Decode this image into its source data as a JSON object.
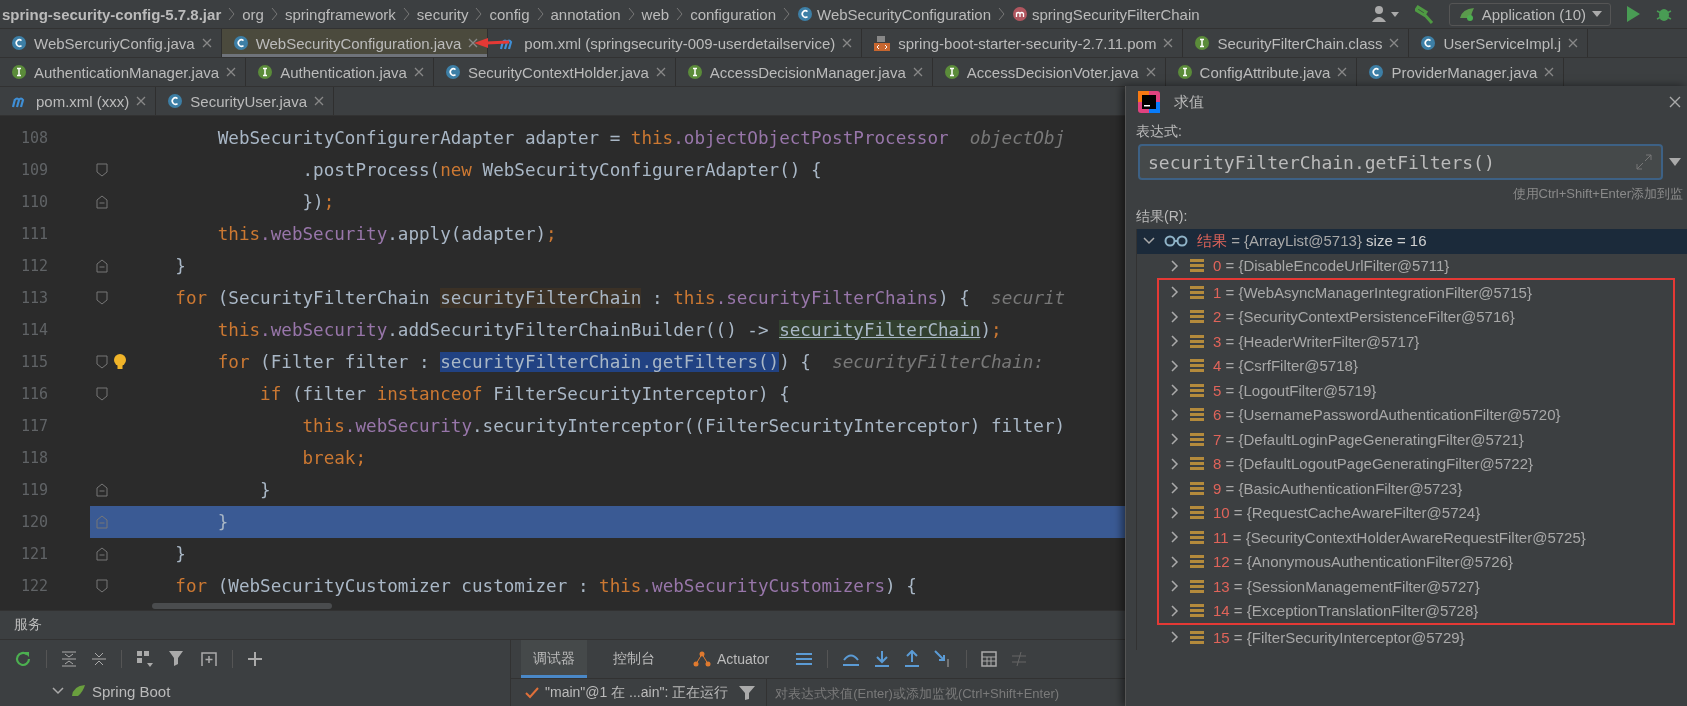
{
  "breadcrumb": [
    {
      "label": "spring-security-config-5.7.8.jar",
      "kind": "jar"
    },
    {
      "label": "org",
      "kind": "package"
    },
    {
      "label": "springframework",
      "kind": "package"
    },
    {
      "label": "security",
      "kind": "package"
    },
    {
      "label": "config",
      "kind": "package"
    },
    {
      "label": "annotation",
      "kind": "package"
    },
    {
      "label": "web",
      "kind": "package"
    },
    {
      "label": "configuration",
      "kind": "package"
    },
    {
      "label": "WebSecurityConfiguration",
      "kind": "class"
    },
    {
      "label": "springSecurityFilterChain",
      "kind": "method"
    }
  ],
  "toolbar": {
    "run_config": "Application (10)"
  },
  "tab_rows": [
    [
      {
        "label": "WebSercuriyConfig.java",
        "kind": "class",
        "selected": false
      },
      {
        "label": "WebSecurityConfiguration.java",
        "kind": "class",
        "selected": true
      },
      {
        "label": "pom.xml (springsecurity-009-userdetailservice)",
        "kind": "maven",
        "selected": false
      },
      {
        "label": "spring-boot-starter-security-2.7.11.pom",
        "kind": "pom",
        "selected": false
      },
      {
        "label": "SecurityFilterChain.class",
        "kind": "interface",
        "selected": false
      },
      {
        "label": "UserServiceImpl.j",
        "kind": "class",
        "selected": false
      }
    ],
    [
      {
        "label": "AuthenticationManager.java",
        "kind": "interface",
        "selected": false
      },
      {
        "label": "Authentication.java",
        "kind": "interface",
        "selected": false
      },
      {
        "label": "SecurityContextHolder.java",
        "kind": "class",
        "selected": false
      },
      {
        "label": "AccessDecisionManager.java",
        "kind": "interface",
        "selected": false
      },
      {
        "label": "AccessDecisionVoter.java",
        "kind": "interface",
        "selected": false
      },
      {
        "label": "ConfigAttribute.java",
        "kind": "interface",
        "selected": false
      },
      {
        "label": "ProviderManager.java",
        "kind": "class",
        "selected": false
      }
    ],
    [
      {
        "label": "pom.xml (xxx)",
        "kind": "maven",
        "selected": false
      },
      {
        "label": "SecurityUser.java",
        "kind": "class",
        "selected": false
      }
    ]
  ],
  "editor": {
    "lines": [
      {
        "number": "108",
        "kind": "plain",
        "bulb": false,
        "current": false,
        "segments": [
          {
            "text": "        WebSecurityConfigurerAdapter adapter = ",
            "kind": "plain"
          },
          {
            "text": "this",
            "kind": "keyword"
          },
          {
            "text": ".objectObjectPostProcessor",
            "kind": "field"
          },
          {
            "text": "  objectObj",
            "kind": "hint"
          }
        ]
      },
      {
        "number": "109",
        "kind": "fold_start",
        "bulb": false,
        "current": false,
        "segments": [
          {
            "text": "                .postProcess(",
            "kind": "plain"
          },
          {
            "text": "new",
            "kind": "keyword"
          },
          {
            "text": " WebSecurityConfigurerAdapter() {",
            "kind": "plain"
          }
        ]
      },
      {
        "number": "110",
        "kind": "fold_end",
        "bulb": false,
        "current": false,
        "segments": [
          {
            "text": "                })",
            "kind": "plain"
          },
          {
            "text": ";",
            "kind": "keyword"
          }
        ]
      },
      {
        "number": "111",
        "kind": "plain",
        "bulb": false,
        "current": false,
        "segments": [
          {
            "text": "        this",
            "kind": "keyword"
          },
          {
            "text": ".webSecurity",
            "kind": "field"
          },
          {
            "text": ".apply(adapter)",
            "kind": "plain"
          },
          {
            "text": ";",
            "kind": "keyword"
          }
        ]
      },
      {
        "number": "112",
        "kind": "fold_end",
        "bulb": false,
        "current": false,
        "segments": [
          {
            "text": "    }",
            "kind": "plain"
          }
        ]
      },
      {
        "number": "113",
        "kind": "fold_start",
        "bulb": false,
        "current": false,
        "segments": [
          {
            "text": "    for",
            "kind": "keyword"
          },
          {
            "text": " (SecurityFilterChain ",
            "kind": "plain"
          },
          {
            "text": "securityFilterChain",
            "kind": "variable"
          },
          {
            "text": " : ",
            "kind": "plain"
          },
          {
            "text": "this",
            "kind": "keyword"
          },
          {
            "text": ".securityFilterChains",
            "kind": "field"
          },
          {
            "text": ") {",
            "kind": "plain"
          },
          {
            "text": "  securit",
            "kind": "hint"
          }
        ]
      },
      {
        "number": "114",
        "kind": "plain",
        "bulb": false,
        "current": false,
        "segments": [
          {
            "text": "        this",
            "kind": "keyword"
          },
          {
            "text": ".webSecurity",
            "kind": "field"
          },
          {
            "text": ".addSecurityFilterChainBuilder(() -> ",
            "kind": "plain"
          },
          {
            "text": "securityFilterChain",
            "kind": "reference"
          },
          {
            "text": ")",
            "kind": "plain"
          },
          {
            "text": ";",
            "kind": "keyword"
          }
        ]
      },
      {
        "number": "115",
        "kind": "fold_start",
        "bulb": true,
        "current": false,
        "segments": [
          {
            "text": "        for",
            "kind": "keyword"
          },
          {
            "text": " (Filter filter : ",
            "kind": "plain"
          },
          {
            "text": "securityFilterChain.getFilters()",
            "kind": "selection"
          },
          {
            "text": ") {",
            "kind": "plain"
          },
          {
            "text": "  securityFilterChain:",
            "kind": "hint"
          }
        ]
      },
      {
        "number": "116",
        "kind": "fold_start",
        "bulb": false,
        "current": false,
        "segments": [
          {
            "text": "            if",
            "kind": "keyword"
          },
          {
            "text": " (filter ",
            "kind": "plain"
          },
          {
            "text": "instanceof",
            "kind": "keyword"
          },
          {
            "text": " FilterSecurityInterceptor) {",
            "kind": "plain"
          }
        ]
      },
      {
        "number": "117",
        "kind": "plain",
        "bulb": false,
        "current": false,
        "segments": [
          {
            "text": "                this",
            "kind": "keyword"
          },
          {
            "text": ".webSecurity",
            "kind": "field"
          },
          {
            "text": ".securityInterceptor((FilterSecurityInterceptor) filter)",
            "kind": "plain"
          }
        ]
      },
      {
        "number": "118",
        "kind": "plain",
        "bulb": false,
        "current": false,
        "segments": [
          {
            "text": "                break;",
            "kind": "keyword"
          }
        ]
      },
      {
        "number": "119",
        "kind": "fold_end",
        "bulb": false,
        "current": false,
        "segments": [
          {
            "text": "            }",
            "kind": "plain"
          }
        ]
      },
      {
        "number": "120",
        "kind": "fold_end",
        "bulb": false,
        "current": true,
        "segments": [
          {
            "text": "        }",
            "kind": "plain"
          }
        ]
      },
      {
        "number": "121",
        "kind": "fold_end",
        "bulb": false,
        "current": false,
        "segments": [
          {
            "text": "    }",
            "kind": "plain"
          }
        ]
      },
      {
        "number": "122",
        "kind": "fold_start",
        "bulb": false,
        "current": false,
        "segments": [
          {
            "text": "    for",
            "kind": "keyword"
          },
          {
            "text": " (WebSecurityCustomizer customizer : ",
            "kind": "plain"
          },
          {
            "text": "this",
            "kind": "keyword"
          },
          {
            "text": ".webSecurityCustomizers",
            "kind": "field"
          },
          {
            "text": ") {",
            "kind": "plain"
          }
        ]
      }
    ]
  },
  "evaluate": {
    "title": "求值",
    "expression_label": "表达式:",
    "expression": "securityFilterChain.getFilters()",
    "hint": "使用Ctrl+Shift+Enter添加到监",
    "result_label": "结果(R):",
    "root": {
      "name": "结果",
      "separator": "=",
      "value": "{ArrayList@5713}",
      "size": "size = 16",
      "expanded": true,
      "selected": true
    },
    "items": [
      {
        "index": "0",
        "separator": "=",
        "value": "{DisableEncodeUrlFilter@5711}",
        "annotated": false
      },
      {
        "index": "1",
        "separator": "=",
        "value": "{WebAsyncManagerIntegrationFilter@5715}",
        "annotated": true
      },
      {
        "index": "2",
        "separator": "=",
        "value": "{SecurityContextPersistenceFilter@5716}",
        "annotated": true
      },
      {
        "index": "3",
        "separator": "=",
        "value": "{HeaderWriterFilter@5717}",
        "annotated": true
      },
      {
        "index": "4",
        "separator": "=",
        "value": "{CsrfFilter@5718}",
        "annotated": true
      },
      {
        "index": "5",
        "separator": "=",
        "value": "{LogoutFilter@5719}",
        "annotated": true
      },
      {
        "index": "6",
        "separator": "=",
        "value": "{UsernamePasswordAuthenticationFilter@5720}",
        "annotated": true
      },
      {
        "index": "7",
        "separator": "=",
        "value": "{DefaultLoginPageGeneratingFilter@5721}",
        "annotated": true
      },
      {
        "index": "8",
        "separator": "=",
        "value": "{DefaultLogoutPageGeneratingFilter@5722}",
        "annotated": true
      },
      {
        "index": "9",
        "separator": "=",
        "value": "{BasicAuthenticationFilter@5723}",
        "annotated": true
      },
      {
        "index": "10",
        "separator": "=",
        "value": "{RequestCacheAwareFilter@5724}",
        "annotated": true
      },
      {
        "index": "11",
        "separator": "=",
        "value": "{SecurityContextHolderAwareRequestFilter@5725}",
        "annotated": true
      },
      {
        "index": "12",
        "separator": "=",
        "value": "{AnonymousAuthenticationFilter@5726}",
        "annotated": true
      },
      {
        "index": "13",
        "separator": "=",
        "value": "{SessionManagementFilter@5727}",
        "annotated": true
      },
      {
        "index": "14",
        "separator": "=",
        "value": "{ExceptionTranslationFilter@5728}",
        "annotated": true
      },
      {
        "index": "15",
        "separator": "=",
        "value": "{FilterSecurityInterceptor@5729}",
        "annotated": false
      }
    ]
  },
  "services": {
    "title": "服务",
    "tree": [
      {
        "label": "Spring Boot",
        "expanded": true
      }
    ],
    "tabs": [
      {
        "label": "调试器",
        "selected": true,
        "kind": "text"
      },
      {
        "label": "控制台",
        "selected": false,
        "kind": "text"
      },
      {
        "label": "Actuator",
        "selected": false,
        "kind": "actuator"
      }
    ],
    "thread": "\"main\"@1 在 ...ain\": 正在运行",
    "watch_placeholder": "对表达式求值(Enter)或添加监视(Ctrl+Shift+Enter)"
  }
}
